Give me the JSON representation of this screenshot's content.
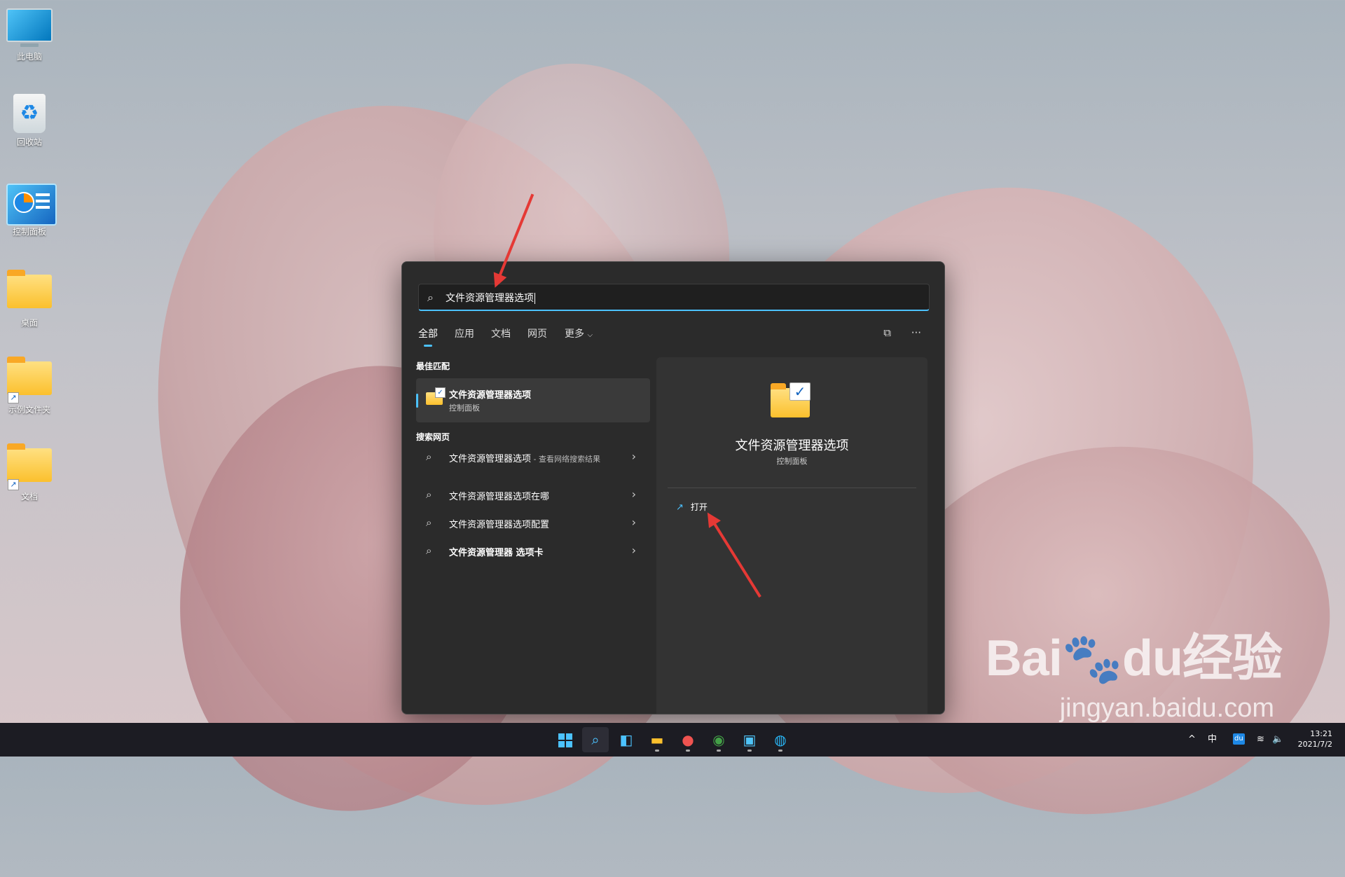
{
  "desktop": {
    "icons": [
      {
        "label": "此电脑"
      },
      {
        "label": "回收站"
      },
      {
        "label": "控制面板"
      },
      {
        "label": "桌面"
      },
      {
        "label": "示例文件夹"
      },
      {
        "label": "文档"
      }
    ]
  },
  "search": {
    "query": "文件资源管理器选项",
    "tabs": [
      "全部",
      "应用",
      "文档",
      "网页",
      "更多"
    ],
    "tools": {
      "more": "···"
    },
    "best_match_title": "最佳匹配",
    "best_match": {
      "name": "文件资源管理器选项",
      "sub": "控制面板"
    },
    "web_title": "搜索网页",
    "web_results": [
      {
        "text": "文件资源管理器选项",
        "sub": " - 查看网络搜索结果"
      },
      {
        "text": "文件资源管理器选项在哪",
        "sub": ""
      },
      {
        "text": "文件资源管理器选项配置",
        "sub": ""
      },
      {
        "text": "文件资源管理器 选项卡",
        "sub": ""
      }
    ],
    "preview": {
      "title": "文件资源管理器选项",
      "sub": "控制面板",
      "open_label": "打开"
    }
  },
  "watermark": {
    "brand": "Bai",
    "brand2": "du",
    "cn": "经验",
    "url": "jingyan.baidu.com"
  },
  "taskbar": {
    "tray": {
      "chevron": "^",
      "ime": "中",
      "baidu": "du"
    },
    "time": "13:21",
    "date": "2021/7/2"
  },
  "colors": {
    "accent": "#4cc2ff",
    "annotation": "#e53935"
  }
}
